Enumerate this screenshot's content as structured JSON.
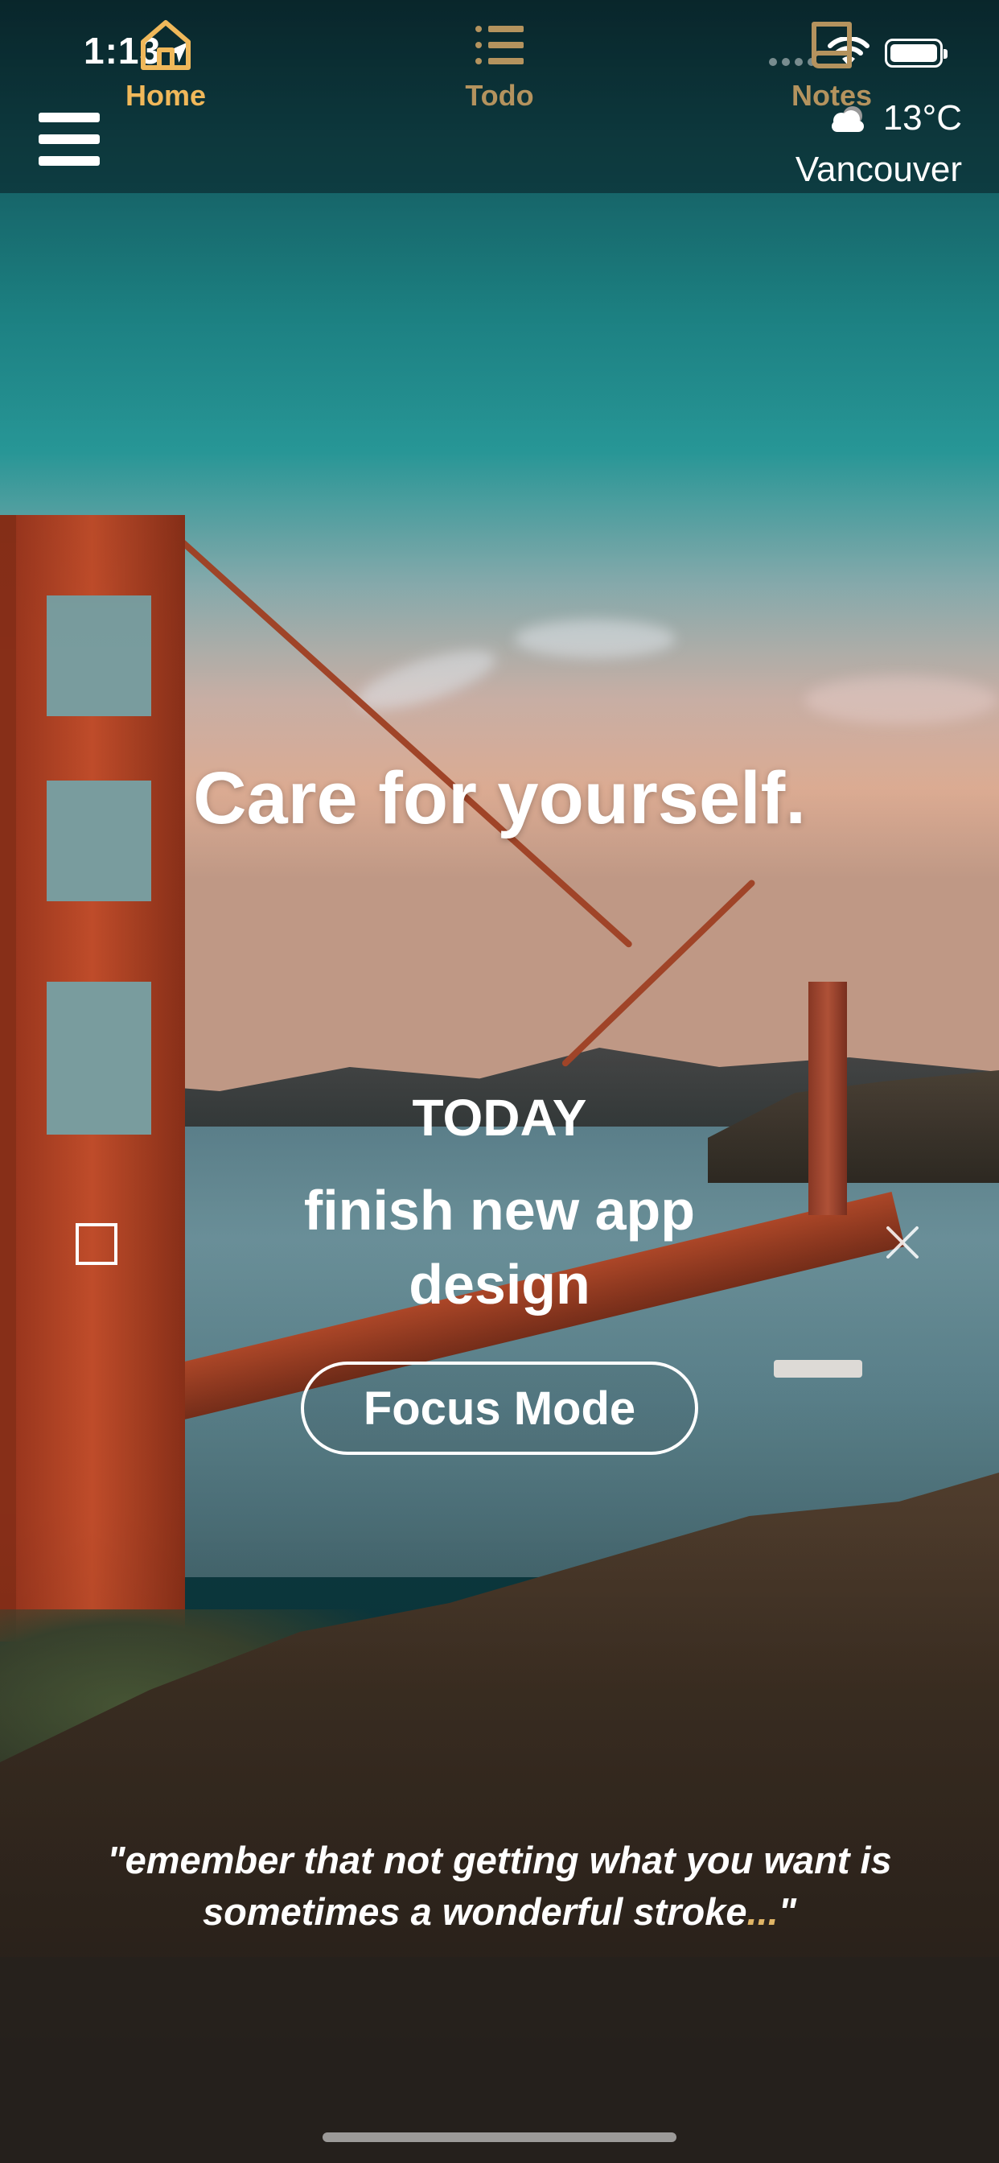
{
  "status_bar": {
    "time": "1:13",
    "location_icon": "location-arrow-icon",
    "signal_icon": "cell-signal-icon",
    "wifi_icon": "wifi-icon",
    "battery_icon": "battery-icon"
  },
  "header": {
    "menu_icon": "hamburger-menu-icon",
    "weather": {
      "icon": "cloud-icon",
      "temperature": "13°C",
      "city": "Vancouver"
    }
  },
  "main": {
    "headline": "Care for yourself.",
    "today_label": "TODAY",
    "task": {
      "text": "finish new app design",
      "checked": false
    },
    "focus_button_label": "Focus Mode",
    "quote_text": "\"emember that not getting what you want is sometimes a wonderful stroke",
    "quote_ellipsis": "...",
    "quote_end": "\""
  },
  "tabs": [
    {
      "label": "Home",
      "icon": "home-icon",
      "active": true
    },
    {
      "label": "Todo",
      "icon": "list-icon",
      "active": false
    },
    {
      "label": "Notes",
      "icon": "book-icon",
      "active": false
    }
  ],
  "colors": {
    "accent_active": "#f0b85a",
    "accent_inactive": "#b4935e",
    "quote_ellipsis": "#e0b566"
  }
}
